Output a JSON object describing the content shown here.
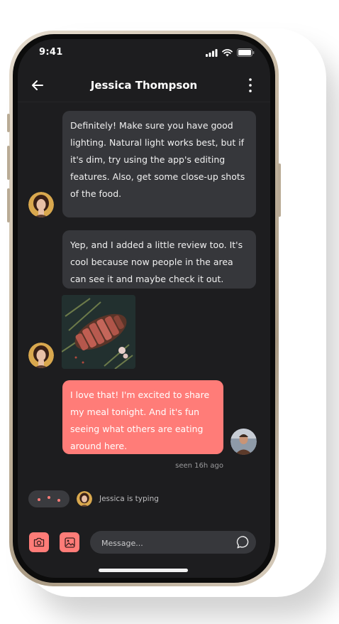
{
  "status_bar": {
    "time": "9:41"
  },
  "header": {
    "title": "Jessica Thompson"
  },
  "messages": [
    {
      "from": "Jessica",
      "text": "Definitely! Make sure you have good lighting. Natural light works best, but if it's dim, try using the app's editing features. Also, get some close-up shots of the food."
    },
    {
      "from": "Jessica",
      "text": "Yep, and I added a little review too. It's cool because now people in the area can see it and maybe check it out."
    },
    {
      "from": "Jessica",
      "image": "steak-photo"
    },
    {
      "from": "me",
      "text": "I love that! I'm excited to share my meal tonight. And it's fun seeing what others are eating around here."
    }
  ],
  "seen": "seen 16h ago",
  "typing": "Jessica is typing",
  "composer": {
    "placeholder": "Message..."
  },
  "colors": {
    "accent": "#ff7c78",
    "background": "#1d1d1f",
    "bubble_in": "#36373b"
  }
}
